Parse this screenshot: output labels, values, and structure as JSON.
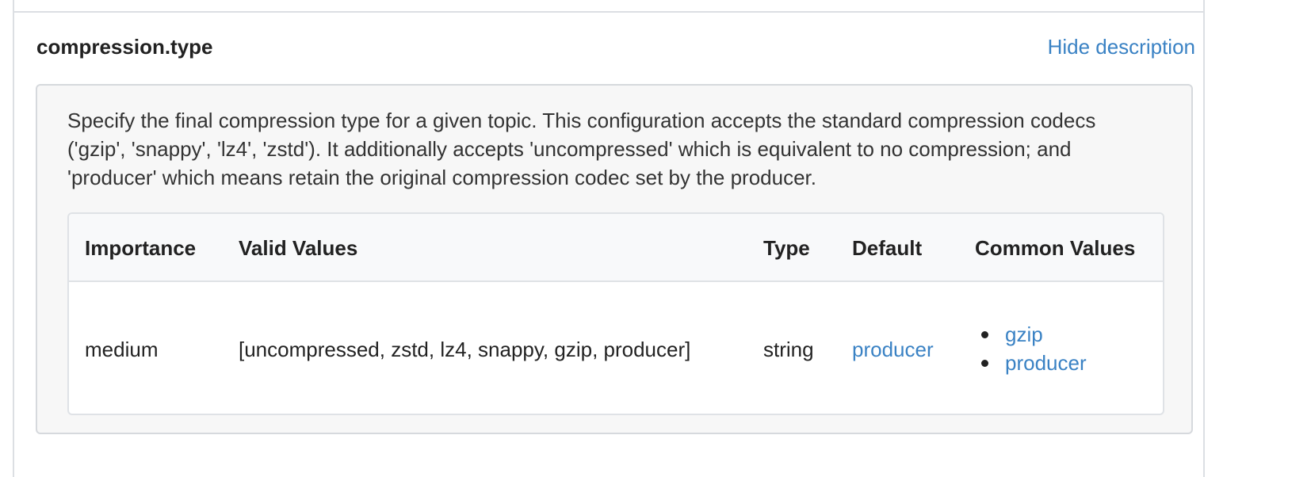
{
  "config": {
    "name": "compression.type",
    "toggle_label": "Hide description",
    "description": "Specify the final compression type for a given topic. This configuration accepts the standard compression codecs ('gzip', 'snappy', 'lz4', 'zstd'). It additionally accepts 'uncompressed' which is equivalent to no compression; and 'producer' which means retain the original compression codec set by the producer."
  },
  "table": {
    "headers": {
      "importance": "Importance",
      "valid_values": "Valid Values",
      "type": "Type",
      "default": "Default",
      "common_values": "Common Values"
    },
    "row": {
      "importance": "medium",
      "valid_values": "[uncompressed, zstd, lz4, snappy, gzip, producer]",
      "type": "string",
      "default": "producer",
      "common_values": [
        "gzip",
        "producer"
      ]
    }
  },
  "colors": {
    "link": "#3a82c4",
    "box_background": "#f7f7f7",
    "header_background": "#f8f9fa",
    "border": "#dcdfe3"
  }
}
